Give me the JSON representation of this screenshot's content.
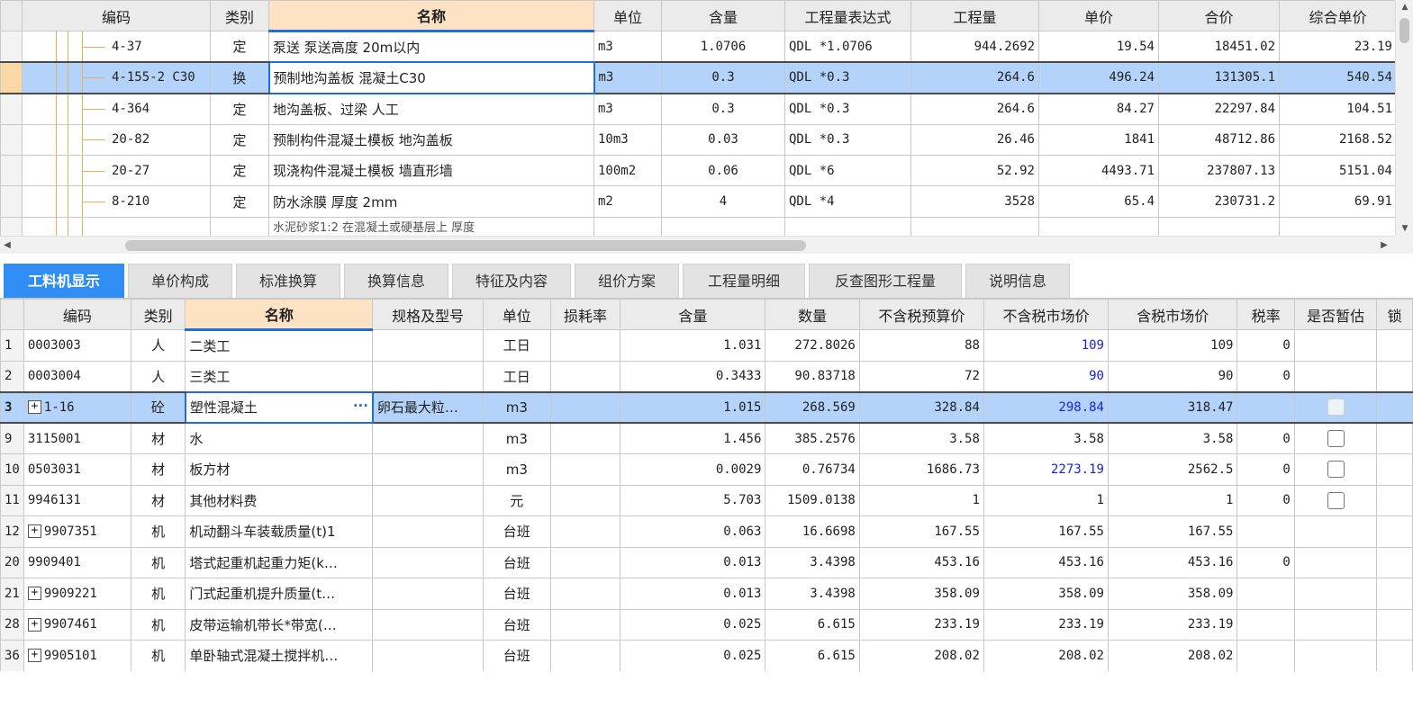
{
  "upper_grid": {
    "columns": [
      "编码",
      "类别",
      "名称",
      "单位",
      "含量",
      "工程量表达式",
      "工程量",
      "单价",
      "合价",
      "综合单价"
    ],
    "rows": [
      {
        "code": "4-37",
        "type": "定",
        "name": "泵送 泵送高度 20m以内",
        "unit": "m3",
        "content": "1.0706",
        "expr": "QDL *1.0706",
        "qty": "944.2692",
        "price": "19.54",
        "total": "18451.02",
        "unit_price": "23.19"
      },
      {
        "code": "4-155-2 C30",
        "type": "换",
        "name": "预制地沟盖板 混凝土C30",
        "unit": "m3",
        "content": "0.3",
        "expr": "QDL *0.3",
        "qty": "264.6",
        "price": "496.24",
        "total": "131305.1",
        "unit_price": "540.54"
      },
      {
        "code": "4-364",
        "type": "定",
        "name": "地沟盖板、过梁 人工",
        "unit": "m3",
        "content": "0.3",
        "expr": "QDL *0.3",
        "qty": "264.6",
        "price": "84.27",
        "total": "22297.84",
        "unit_price": "104.51"
      },
      {
        "code": "20-82",
        "type": "定",
        "name": "预制构件混凝土模板 地沟盖板",
        "unit": "10m3",
        "content": "0.03",
        "expr": "QDL *0.3",
        "qty": "26.46",
        "price": "1841",
        "total": "48712.86",
        "unit_price": "2168.52"
      },
      {
        "code": "20-27",
        "type": "定",
        "name": "现浇构件混凝土模板 墙直形墙",
        "unit": "100m2",
        "content": "0.06",
        "expr": "QDL *6",
        "qty": "52.92",
        "price": "4493.71",
        "total": "237807.13",
        "unit_price": "5151.04"
      },
      {
        "code": "8-210",
        "type": "定",
        "name": "防水涂膜 厚度 2mm",
        "unit": "m2",
        "content": "4",
        "expr": "QDL *4",
        "qty": "3528",
        "price": "65.4",
        "total": "230731.2",
        "unit_price": "69.91"
      }
    ],
    "partial_row_name": "水泥砂浆1:2 在混凝土或硬基层上 厚度"
  },
  "tabs": [
    "工料机显示",
    "单价构成",
    "标准换算",
    "换算信息",
    "特征及内容",
    "组价方案",
    "工程量明细",
    "反查图形工程量",
    "说明信息"
  ],
  "lower_grid": {
    "columns": [
      "编码",
      "类别",
      "名称",
      "规格及型号",
      "单位",
      "损耗率",
      "含量",
      "数量",
      "不含税预算价",
      "不含税市场价",
      "含税市场价",
      "税率",
      "是否暂估",
      "锁"
    ],
    "rows": [
      {
        "no": "1",
        "code": "0003003",
        "expand": false,
        "type": "人",
        "name": "二类工",
        "spec": "",
        "unit": "工日",
        "loss": "",
        "content": "1.031",
        "qty": "272.8026",
        "budget": "88",
        "market": "109",
        "market_blue": true,
        "tax_market": "109",
        "tax_rate": "0",
        "check": ""
      },
      {
        "no": "2",
        "code": "0003004",
        "expand": false,
        "type": "人",
        "name": "三类工",
        "spec": "",
        "unit": "工日",
        "loss": "",
        "content": "0.3433",
        "qty": "90.83718",
        "budget": "72",
        "market": "90",
        "market_blue": true,
        "tax_market": "90",
        "tax_rate": "0",
        "check": ""
      },
      {
        "no": "3",
        "code": "1-16",
        "expand": true,
        "type": "砼",
        "name": "塑性混凝土",
        "spec": "卵石最大粒…",
        "unit": "m3",
        "loss": "",
        "content": "1.015",
        "qty": "268.569",
        "budget": "328.84",
        "market": "298.84",
        "market_blue": true,
        "tax_market": "318.47",
        "tax_rate": "",
        "check": "dim"
      },
      {
        "no": "9",
        "code": "3115001",
        "expand": false,
        "type": "材",
        "name": "水",
        "spec": "",
        "unit": "m3",
        "loss": "",
        "content": "1.456",
        "qty": "385.2576",
        "budget": "3.58",
        "market": "3.58",
        "market_blue": false,
        "tax_market": "3.58",
        "tax_rate": "0",
        "check": "box"
      },
      {
        "no": "10",
        "code": "0503031",
        "expand": false,
        "type": "材",
        "name": "板方材",
        "spec": "",
        "unit": "m3",
        "loss": "",
        "content": "0.0029",
        "qty": "0.76734",
        "budget": "1686.73",
        "market": "2273.19",
        "market_blue": true,
        "tax_market": "2562.5",
        "tax_rate": "0",
        "check": "box"
      },
      {
        "no": "11",
        "code": "9946131",
        "expand": false,
        "type": "材",
        "name": "其他材料费",
        "spec": "",
        "unit": "元",
        "loss": "",
        "content": "5.703",
        "qty": "1509.0138",
        "budget": "1",
        "market": "1",
        "market_blue": false,
        "tax_market": "1",
        "tax_rate": "0",
        "check": "box"
      },
      {
        "no": "12",
        "code": "9907351",
        "expand": true,
        "type": "机",
        "name": "机动翻斗车装载质量(t)1",
        "spec": "",
        "unit": "台班",
        "loss": "",
        "content": "0.063",
        "qty": "16.6698",
        "budget": "167.55",
        "market": "167.55",
        "market_blue": false,
        "tax_market": "167.55",
        "tax_rate": "",
        "check": ""
      },
      {
        "no": "20",
        "code": "9909401",
        "expand": false,
        "type": "机",
        "name": "塔式起重机起重力矩(k…",
        "spec": "",
        "unit": "台班",
        "loss": "",
        "content": "0.013",
        "qty": "3.4398",
        "budget": "453.16",
        "market": "453.16",
        "market_blue": false,
        "tax_market": "453.16",
        "tax_rate": "0",
        "check": ""
      },
      {
        "no": "21",
        "code": "9909221",
        "expand": true,
        "type": "机",
        "name": "门式起重机提升质量(t…",
        "spec": "",
        "unit": "台班",
        "loss": "",
        "content": "0.013",
        "qty": "3.4398",
        "budget": "358.09",
        "market": "358.09",
        "market_blue": false,
        "tax_market": "358.09",
        "tax_rate": "",
        "check": ""
      },
      {
        "no": "28",
        "code": "9907461",
        "expand": true,
        "type": "机",
        "name": "皮带运输机带长*带宽(…",
        "spec": "",
        "unit": "台班",
        "loss": "",
        "content": "0.025",
        "qty": "6.615",
        "budget": "233.19",
        "market": "233.19",
        "market_blue": false,
        "tax_market": "233.19",
        "tax_rate": "",
        "check": ""
      },
      {
        "no": "36",
        "code": "9905101",
        "expand": true,
        "type": "机",
        "name": "单卧轴式混凝土搅拌机…",
        "spec": "",
        "unit": "台班",
        "loss": "",
        "content": "0.025",
        "qty": "6.615",
        "budget": "208.02",
        "market": "208.02",
        "market_blue": false,
        "tax_market": "208.02",
        "tax_rate": "",
        "check": ""
      }
    ]
  },
  "colors": {
    "selection": "#b3d3fb",
    "active_tab": "#2f8df3",
    "name_header": "#fde3c4",
    "market_blue": "#1a22e0"
  },
  "icons": {
    "expand": "plus-box-icon",
    "more": "ellipsis-icon",
    "scroll_up": "triangle-up-icon",
    "scroll_down": "triangle-down-icon",
    "scroll_left": "triangle-left-icon",
    "scroll_right": "triangle-right-icon"
  }
}
